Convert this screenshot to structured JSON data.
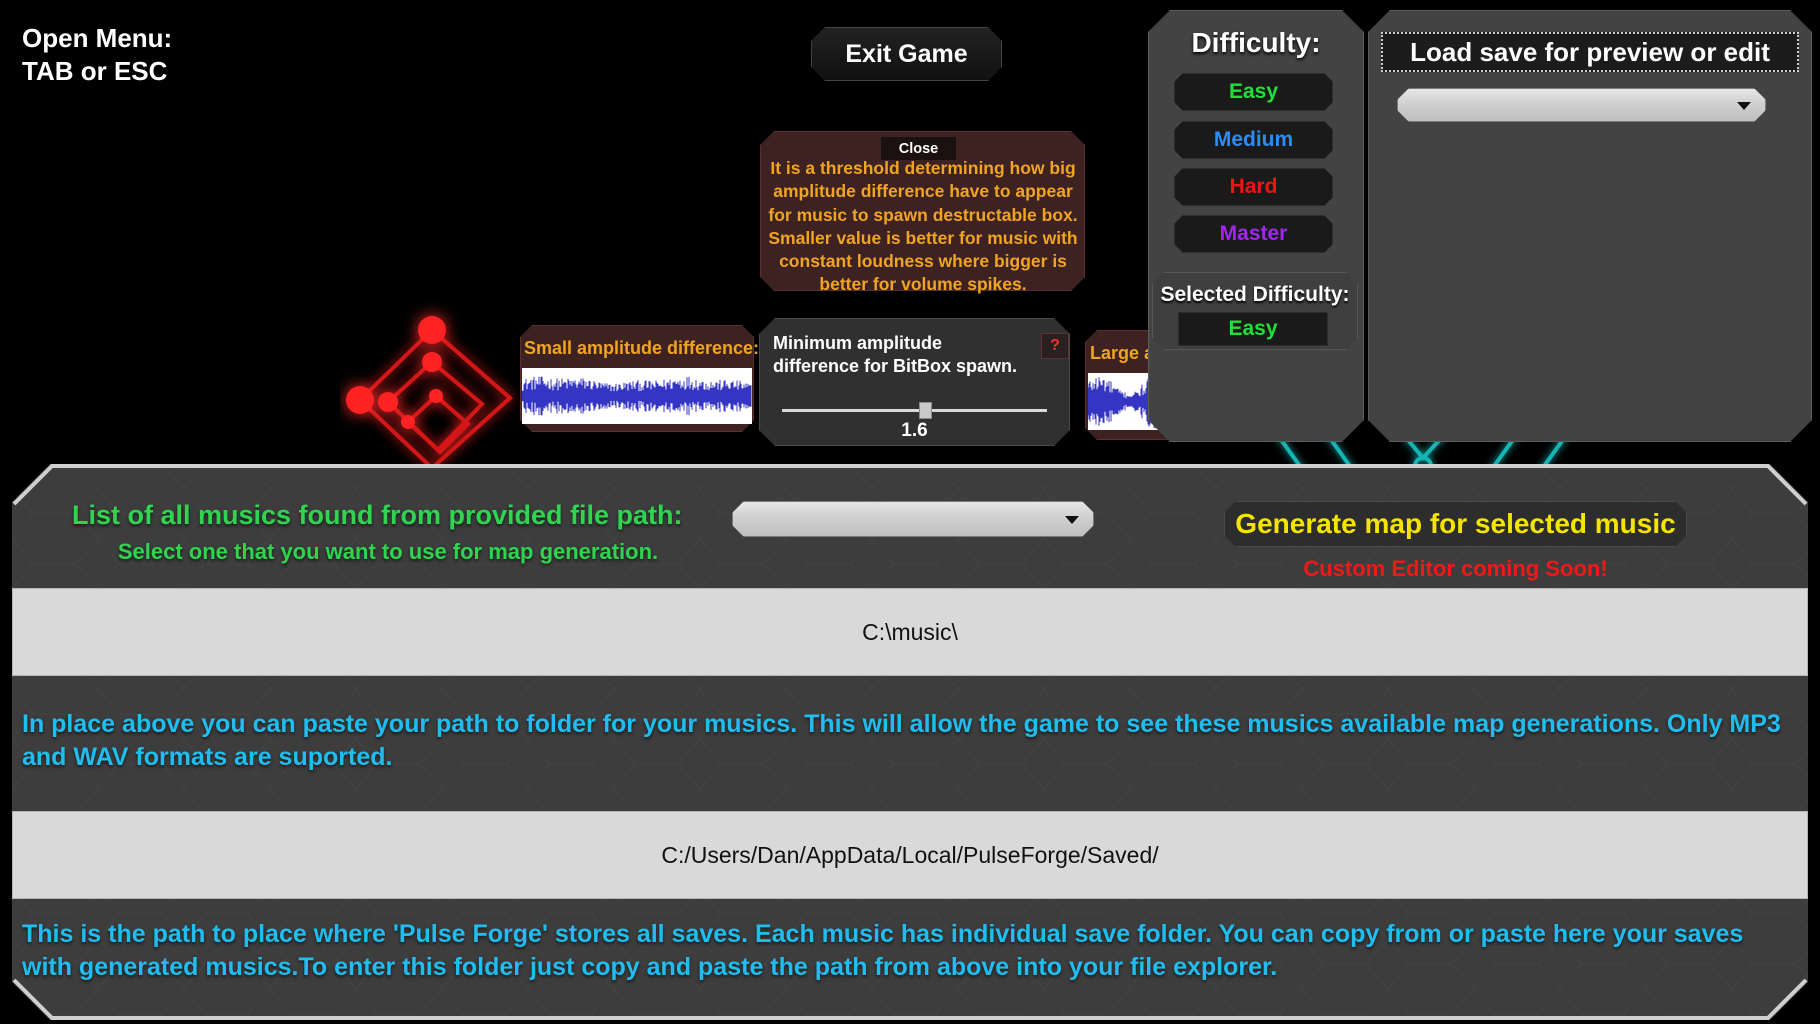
{
  "hints": {
    "open_menu": "Open Menu:\nTAB or ESC"
  },
  "topbar": {
    "exit_game_label": "Exit Game"
  },
  "tooltip": {
    "close_label": "Close",
    "body": "It is a threshold determining how big amplitude difference have to appear for music to spawn destructable box. Smaller value is better for music with constant loudness where bigger is better for volume spikes."
  },
  "amplitude": {
    "small_card_title": "Small amplitude difference:",
    "large_card_title": "Large amplitude difference",
    "slider_label": "Minimum amplitude difference for BitBox spawn.",
    "help_glyph": "?",
    "slider_value": "1.6",
    "slider_percent": 54
  },
  "difficulty": {
    "title": "Difficulty:",
    "options": [
      {
        "label": "Easy",
        "color": "#21e03a"
      },
      {
        "label": "Medium",
        "color": "#2e8bf5"
      },
      {
        "label": "Hard",
        "color": "#f01414"
      },
      {
        "label": "Master",
        "color": "#a126f0"
      }
    ],
    "selected_title": "Selected Difficulty:",
    "selected_label": "Easy",
    "selected_color": "#21e03a"
  },
  "load_save": {
    "title": "Load save for preview or edit",
    "select_value": "",
    "caret_icon": "chevron-down-icon"
  },
  "music": {
    "list_label": "List of all musics found from provided file path:",
    "list_sublabel": "Select one that you want to use for map generation.",
    "select_value": "",
    "caret_icon": "chevron-down-icon"
  },
  "generate": {
    "button_label": "Generate map for selected music",
    "note": "Custom Editor coming Soon!"
  },
  "paths": {
    "music_path_value": "C:\\music\\",
    "music_path_info": "In place above you can paste your path to folder for your musics. This will allow the game to see these musics available map generations. Only MP3 and WAV formats are suported.",
    "save_path_value": "C:/Users/Dan/AppData/Local/PulseForge/Saved/",
    "save_path_info": "This is the path to place where 'Pulse Forge' stores all saves. Each music has individual save folder. You can copy from or paste here your saves with generated musics.To enter this folder just copy and paste the path from above into your file explorer."
  },
  "colors": {
    "green": "#2fd44f",
    "cyan": "#20bdf0",
    "yellow": "#f5e400",
    "red": "#f11818",
    "orange": "#f0a423",
    "panel": "#3d3d3d"
  }
}
